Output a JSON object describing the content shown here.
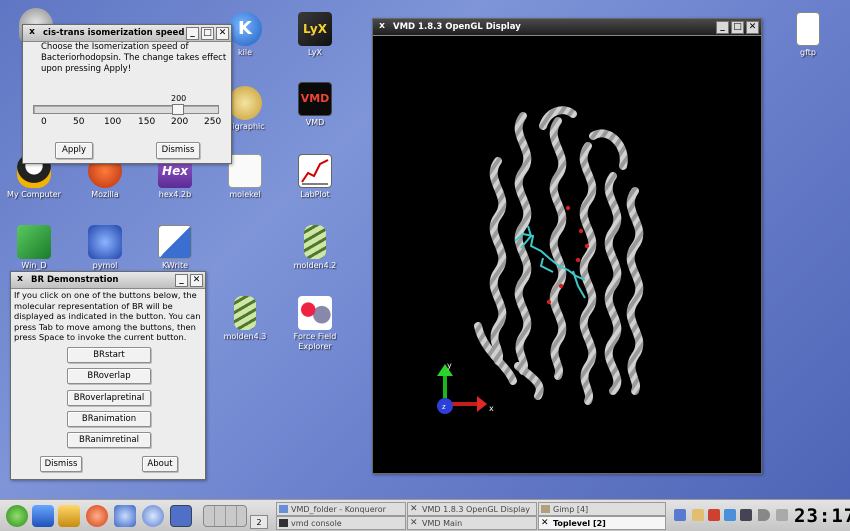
{
  "desktop": {
    "icons": [
      {
        "label": "",
        "name": "recycle-bin-icon"
      },
      {
        "label": "kile",
        "name": "kile-icon"
      },
      {
        "label": "LyX",
        "name": "lyx-icon"
      },
      {
        "label": "VMD",
        "name": "vmd-icon"
      },
      {
        "label": "oligraphic",
        "name": "oligraphic-icon"
      },
      {
        "label": "My Computer",
        "name": "my-computer-icon"
      },
      {
        "label": "Mozilla",
        "name": "mozilla-icon"
      },
      {
        "label": "hex4.2b",
        "name": "hex-icon"
      },
      {
        "label": "molekel",
        "name": "molekel-icon"
      },
      {
        "label": "LabPlot",
        "name": "labplot-icon"
      },
      {
        "label": "Win_D",
        "name": "win-d-icon"
      },
      {
        "label": "pymol",
        "name": "pymol-icon"
      },
      {
        "label": "KWrite",
        "name": "kwrite-icon"
      },
      {
        "label": "molden4.2",
        "name": "molden-icon"
      },
      {
        "label": "molden4.3",
        "name": "molden-43-icon"
      },
      {
        "label": "Force Field Explorer",
        "name": "force-field-explorer-icon"
      },
      {
        "label": "gftp",
        "name": "gftp-icon"
      }
    ]
  },
  "speed_dialog": {
    "title": "cis-trans isomerization speed",
    "message": "Choose the Isomerization speed of Bacteriorhodopsin. The change takes effect upon pressing Apply!",
    "slider_value": "200",
    "slider_level": 0.8,
    "ticks": [
      "0",
      "50",
      "100",
      "150",
      "200",
      "250"
    ],
    "apply_label": "Apply",
    "dismiss_label": "Dismiss"
  },
  "br_demo": {
    "title": "BR Demonstration",
    "message": "If you click on one of the buttons below, the molecular representation of BR will be displayed as indicated in the button. You can press Tab to move among the buttons, then press Space to invoke the current button.",
    "buttons": [
      "BRstart",
      "BRoverlap",
      "BRoverlapretinal",
      "BRanimation",
      "BRanimretinal"
    ],
    "dismiss_label": "Dismiss",
    "about_label": "About"
  },
  "vmd_display": {
    "title": "VMD 1.8.3 OpenGL Display",
    "axis_y": "y",
    "axis_x": "x",
    "axis_z": "z"
  },
  "taskbar": {
    "desktop_number": "2",
    "tasks": [
      {
        "label": "VMD_folder - Konqueror",
        "active": false
      },
      {
        "label": "VMD 1.8.3 OpenGL Display",
        "active": false
      },
      {
        "label": "Gimp [4]",
        "active": false
      },
      {
        "label": "vmd console",
        "active": false
      },
      {
        "label": "VMD Main",
        "active": false
      },
      {
        "label": "Toplevel [2]",
        "active": true
      }
    ],
    "clock": "23:17"
  },
  "colors": {
    "desktop": "#6a80cc",
    "titlebar_active": "#1f1f1f",
    "protein": "#b8b8b8",
    "retinal": "#3fc8c8",
    "water": "#d02020"
  }
}
